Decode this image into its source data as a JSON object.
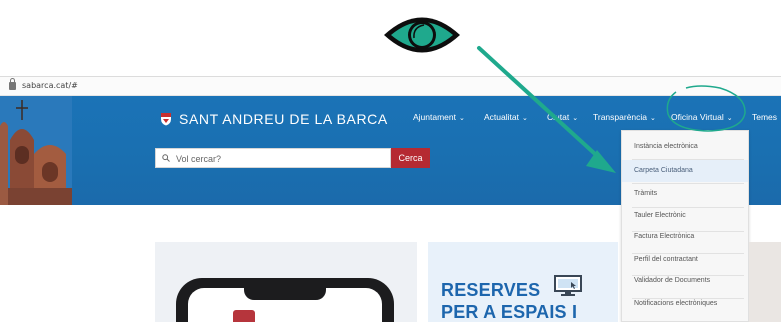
{
  "browser": {
    "url": "sabarca.cat/#"
  },
  "header": {
    "site_name": "SANT ANDREU DE LA BARCA",
    "nav": [
      {
        "label": "Ajuntament",
        "caret": "⌄"
      },
      {
        "label": "Actualitat",
        "caret": "⌄"
      },
      {
        "label": "Ciutat",
        "caret": "⌄"
      },
      {
        "label": "Transparència",
        "caret": "⌄"
      },
      {
        "label": "Oficina Virtual",
        "caret": "⌄"
      },
      {
        "label": "Temes",
        "caret": ""
      }
    ],
    "search": {
      "placeholder": "Vol cercar?",
      "button_label": "Cerca"
    }
  },
  "dropdown": {
    "items": [
      "Instància electrònica",
      "Carpeta Ciutadana",
      "Tràmits",
      "Tauler Electrònic",
      "Factura Electrònica",
      "Perfil del contractant",
      "Validador de Documents",
      "Notificacions electròniques"
    ],
    "highlighted_index": 1
  },
  "content": {
    "reserves_line1": "RESERVES",
    "reserves_line2": "PER A ESPAIS I"
  },
  "colors": {
    "header_blue": "#1b73b7",
    "search_red": "#b52a32",
    "annotation_teal": "#1fa98d",
    "reserves_blue": "#1d66ad"
  },
  "icons": {
    "eye": "eye-icon",
    "arrow": "pointer-arrow",
    "circle": "highlight-circle"
  }
}
